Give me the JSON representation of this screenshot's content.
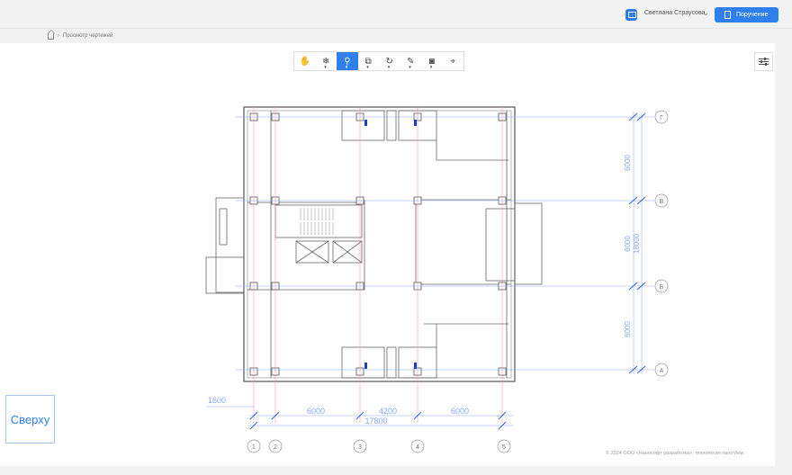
{
  "header": {
    "user_name": "Светлана Страусова",
    "task_button_label": "Поручение"
  },
  "breadcrumb": {
    "current": "Просмотр чертежей"
  },
  "toolbar": {
    "tools": [
      {
        "icon": "hand-icon",
        "active": false
      },
      {
        "icon": "snowflake-icon",
        "active": false
      },
      {
        "icon": "zoom-icon",
        "active": true
      },
      {
        "icon": "box-icon",
        "active": false
      },
      {
        "icon": "rotate-icon",
        "active": false
      },
      {
        "icon": "pin-icon",
        "active": false
      },
      {
        "icon": "camera-icon",
        "active": false
      },
      {
        "icon": "measure-icon",
        "active": false
      }
    ]
  },
  "drawing": {
    "axes_letters": [
      "Г",
      "В",
      "Б",
      "А"
    ],
    "axes_numbers": [
      "1",
      "2",
      "3",
      "4",
      "5"
    ],
    "dims_bottom": [
      "1600",
      "6000",
      "4200",
      "6000",
      "17800"
    ],
    "dims_right": [
      "6000",
      "6000",
      "18000",
      "6000"
    ]
  },
  "view_cube": {
    "label": "Сверху"
  },
  "footer": {
    "copyright": "© 2024 ООО «Нанософт разработка», технология nanoView"
  }
}
